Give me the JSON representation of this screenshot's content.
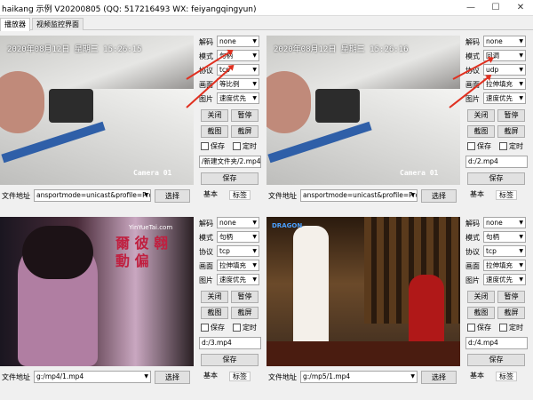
{
  "window": {
    "title": "haikang 示例 V20200805 (QQ: 517216493 WX: feiyangqingyun)",
    "min": "—",
    "max": "☐",
    "close": "✕"
  },
  "tabs": [
    "播放器",
    "视频监控界面"
  ],
  "labels": {
    "decode": "解码",
    "mode": "模式",
    "protocol": "协议",
    "picture": "画面",
    "image": "图片",
    "close": "关闭",
    "pause": "暂停",
    "snapshot": "截图",
    "snapshot2": "截屏",
    "save_chk": "保存",
    "timer_chk": "定时",
    "save_btn": "保存",
    "addr": "文件地址",
    "choose": "选择",
    "basic": "基本",
    "tags": "标签"
  },
  "panels": [
    {
      "decode": "none",
      "mode": "句柄",
      "protocol": "tcp",
      "picture": "等比例",
      "image": "速度优先",
      "path": "/新建文件夹/2.mp4",
      "addr": "ansportmode=unicast&profile=Profile_2",
      "osd": "2020年08月12日 星期三 15:26:15",
      "camera": "Camera 01"
    },
    {
      "decode": "none",
      "mode": "回调",
      "protocol": "udp",
      "picture": "拉伸填充",
      "image": "速度优先",
      "path": "d:/2.mp4",
      "addr": "ansportmode=unicast&profile=Profile_2",
      "osd": "2020年08月12日 星期三 15:26:16",
      "camera": "Camera 01"
    },
    {
      "decode": "none",
      "mode": "句柄",
      "protocol": "tcp",
      "picture": "拉伸填充",
      "image": "速度优先",
      "path": "d:/3.mp4",
      "addr": "g:/mp4/1.mp4",
      "overlay": "YinYueTai.com",
      "lyric": "爾 彼 翱 動 偏"
    },
    {
      "decode": "none",
      "mode": "句柄",
      "protocol": "tcp",
      "picture": "拉伸填充",
      "image": "速度优先",
      "path": "d:/4.mp4",
      "addr": "g:/mp5/1.mp4",
      "overlay": "DRAGON"
    }
  ],
  "colors": {
    "arrow": "#e03020"
  }
}
